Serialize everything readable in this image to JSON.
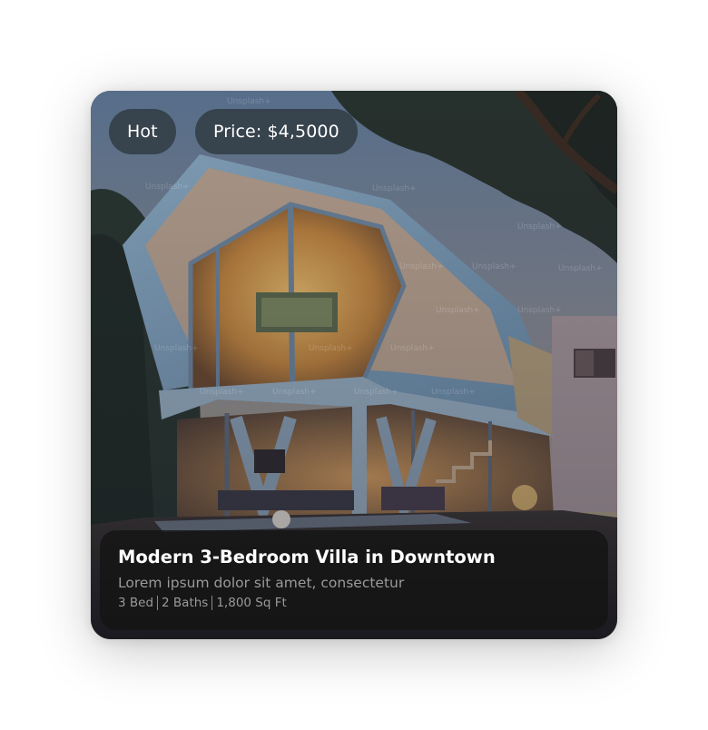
{
  "badges": {
    "hot": "Hot",
    "price": "Price: $4,5000"
  },
  "listing": {
    "title": "Modern 3-Bedroom Villa in Downtown",
    "description": "Lorem ipsum dolor sit amet, consectetur",
    "specs": [
      "3 Bed",
      "2 Baths",
      "1,800 Sq Ft"
    ]
  },
  "photo": {
    "watermark": "Unsplash+"
  }
}
